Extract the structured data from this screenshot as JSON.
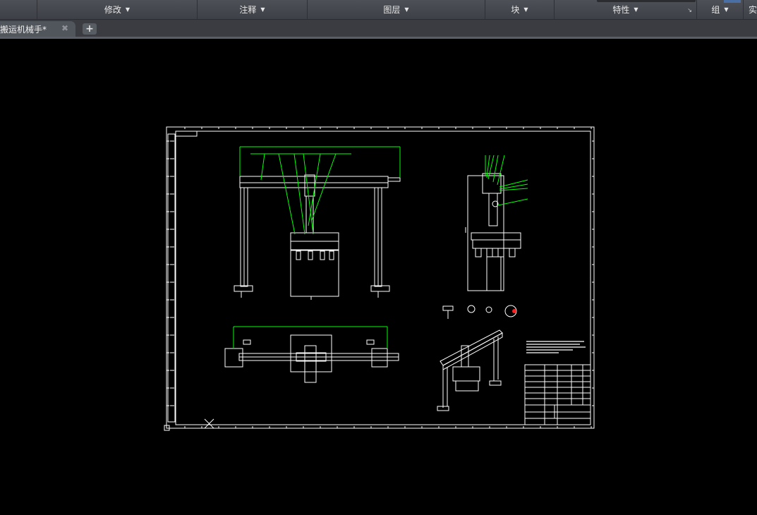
{
  "ribbon": {
    "panels": [
      {
        "label": "修改",
        "has_dropdown": true
      },
      {
        "label": "注释",
        "has_dropdown": true
      },
      {
        "label": "图层",
        "has_dropdown": true
      },
      {
        "label": "块",
        "has_dropdown": true
      },
      {
        "label": "特性",
        "has_dropdown": true
      },
      {
        "label": "组",
        "has_dropdown": true
      },
      {
        "label": "实",
        "has_dropdown": false
      }
    ],
    "dropdown_glyph": "▼",
    "launcher_glyph": "↘"
  },
  "tabs": {
    "active_file": "搬运机械手*",
    "close_glyph": "✖",
    "new_tab_glyph": "+"
  },
  "drawing": {
    "background_color": "#000000",
    "line_color": "#ffffff",
    "dimension_color": "#00ff00",
    "highlight_color": "#ff2020",
    "views": [
      "front-view",
      "side-view",
      "top-view",
      "isometric-view",
      "detail-views",
      "title-block"
    ]
  },
  "icons": {
    "ucs": "ucs-icon"
  }
}
